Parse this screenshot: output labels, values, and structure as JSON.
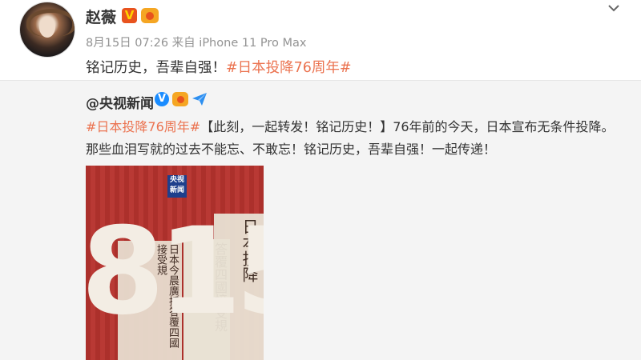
{
  "post": {
    "username": "赵薇",
    "v_badge": "V",
    "meta": "8月15日 07:26 来自 iPhone 11 Pro Max",
    "text": "铭记历史，吾辈自强！",
    "hashtag": "#日本投降76周年#"
  },
  "repost": {
    "source_name": "@央视新闻",
    "source_v": "V",
    "hashtag": "#日本投降76周年#",
    "text": "【此刻，一起转发！铭记历史！】76年前的今天，日本宣布无条件投降。那些血泪写就的过去不能忘、不敢忘！铭记历史，吾辈自强！一起传递！",
    "image": {
      "logo": "央视新闻",
      "number": "815",
      "paper_text_1": "日本今晨廣播答覆四國接受規",
      "paper_text_2": "答覆四國接受規",
      "paper_text_3": "日本投降"
    }
  },
  "colors": {
    "hashtag": "#eb7350",
    "meta": "#939393",
    "repost_bg": "#f4f4f4",
    "poster_bg": "#b7332e"
  },
  "icons": {
    "menu": "chevron-down-icon",
    "verified": "verified-v-icon",
    "member": "crown-icon",
    "share": "paper-plane-icon"
  }
}
